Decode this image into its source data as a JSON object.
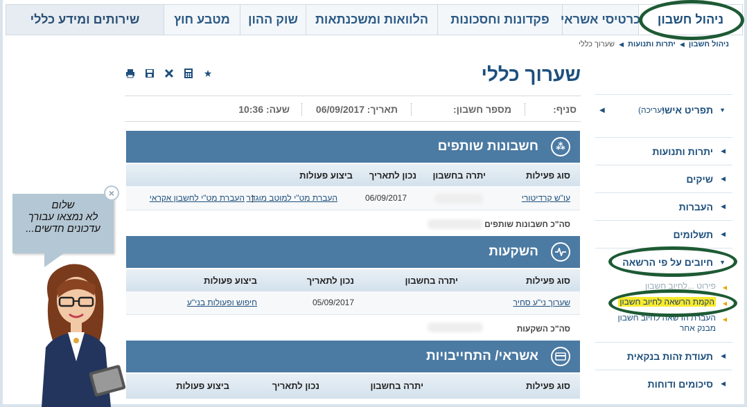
{
  "nav": {
    "tabs": [
      "ניהול חשבון",
      "כרטיסי אשראי",
      "פקדונות וחסכונות",
      "הלוואות ומשכנתאות",
      "שוק ההון",
      "מטבע חוץ",
      "שירותים ומידע כללי"
    ]
  },
  "breadcrumb": {
    "items": [
      "ניהול חשבון",
      "יתרות ותנועות",
      "שערוך כללי"
    ]
  },
  "page": {
    "title": "שערוך כללי"
  },
  "toolbar": {
    "icons": [
      "star-icon",
      "calculator-icon",
      "excel-icon",
      "save-icon",
      "print-icon"
    ]
  },
  "info": {
    "branch_label": "סניף:",
    "account_label": "מספר חשבון:",
    "date_label": "תאריך:",
    "date_value": "06/09/2017",
    "time_label": "שעה:",
    "time_value": "10:36"
  },
  "sidebar": {
    "profile_label": "תפריט אישי",
    "profile_edit": "(עריכה)",
    "items": [
      "יתרות ותנועות",
      "שיקים",
      "העברות",
      "תשלומים",
      "חיובים על פי הרשאה"
    ],
    "subitems": [
      "פירוט ...לחיוב חשבון",
      "הקמת הרשאה לחיוב חשבון",
      "העברת הרשאה לחיוב חשבון מבנק אחר"
    ],
    "bottom_items": [
      "תעודת זהות בנקאית",
      "סיכומים ודוחות"
    ]
  },
  "joint": {
    "title": "חשבונות שותפים",
    "columns": [
      "סוג פעילות",
      "יתרה בחשבון",
      "נכון לתאריך",
      "ביצוע פעולות"
    ],
    "row": {
      "type": "עו\"ש קרדיטורי",
      "date": "06/09/2017",
      "action1": "העברת מט\"י לחשבון אקראי",
      "action_sep": "|",
      "action2": "העברת מט\"י למוטב מוגדר"
    },
    "total_label": "סה\"כ חשבונות שותפים"
  },
  "investments": {
    "title": "השקעות",
    "columns": [
      "סוג פעילות",
      "יתרה בחשבון",
      "נכון לתאריך",
      "ביצוע פעולות"
    ],
    "row": {
      "type": "שערוך ני\"ע סחיר",
      "date": "05/09/2017",
      "action": "חיפוש ופעולות בני\"ע"
    },
    "total_label": "סה\"כ השקעות"
  },
  "credit": {
    "title": "אשראי/ התחייבויות",
    "columns": [
      "סוג פעילות",
      "יתרה בחשבון",
      "נכון לתאריך",
      "ביצוע פעולות"
    ]
  },
  "assistant": {
    "line1": "שלום",
    "line2": "לא נמצאו עבורך",
    "line3": "עדכונים חדשים...",
    "close": "×"
  },
  "colors": {
    "brand": "#1d4f7c",
    "panel": "#4b7aa3",
    "annotation": "#1d5a34",
    "highlight": "#f7ea2e"
  }
}
